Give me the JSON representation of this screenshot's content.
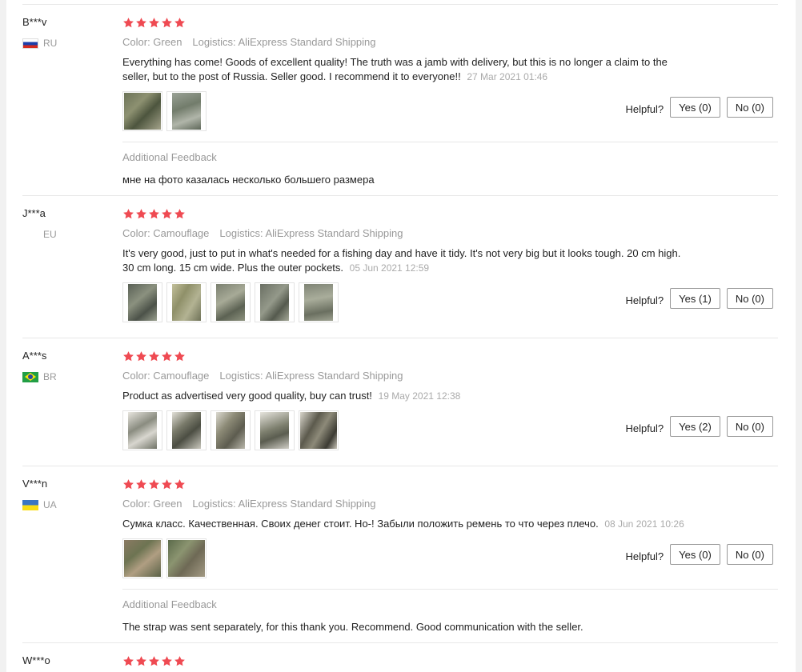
{
  "colors": {
    "star": "#ef4a52",
    "divider": "#e8e8e8",
    "muted": "#999999"
  },
  "helpful_label": "Helpful?",
  "reviews": [
    {
      "user": "B***v",
      "country": "RU",
      "flag": "ru",
      "rating": 5,
      "color": "Color: Green",
      "logistics": "Logistics: AliExpress Standard Shipping",
      "text": "Everything has come! Goods of excellent quality! The truth was a jamb with delivery, but this is no longer a claim to the seller, but to the post of Russia. Seller good. I recommend it to everyone!!",
      "date": "27 Mar 2021 01:46",
      "photos": [
        "green-bag-photo",
        "camouflage-photo"
      ],
      "yes": "Yes (0)",
      "no": "No (0)",
      "additional_label": "Additional Feedback",
      "additional_text": "мне на фото казалась несколько большего размера"
    },
    {
      "user": "J***a",
      "country": "EU",
      "flag": "eu",
      "rating": 5,
      "color": "Color: Camouflage",
      "logistics": "Logistics: AliExpress Standard Shipping",
      "text": "It's very good, just to put in what's needed for a fishing day and have it tidy. It's not very big but it looks tough. 20 cm high. 30 cm long. 15 cm wide. Plus the outer pockets.",
      "date": "05 Jun 2021 12:59",
      "photos": [
        "camo-bag-1",
        "camo-bag-2",
        "camo-bag-3",
        "camo-bag-4",
        "camo-bag-5"
      ],
      "yes": "Yes (1)",
      "no": "No (0)"
    },
    {
      "user": "A***s",
      "country": "BR",
      "flag": "br",
      "rating": 5,
      "color": "Color: Camouflage",
      "logistics": "Logistics: AliExpress Standard Shipping",
      "text": "Product as advertised very good quality, buy can trust!",
      "date": "19 May 2021 12:38",
      "photos": [
        "camo-bag-front",
        "camo-bag-side",
        "camo-bag-back",
        "camo-bag-strap",
        "camo-bag-parts"
      ],
      "yes": "Yes (2)",
      "no": "No (0)"
    },
    {
      "user": "V***n",
      "country": "UA",
      "flag": "ua",
      "rating": 5,
      "color": "Color: Green",
      "logistics": "Logistics: AliExpress Standard Shipping",
      "text": "Сумка класс. Качественная. Своих денег стоит. Но-! Забыли положить ремень то что через плечо.",
      "date": "08 Jun 2021 10:26",
      "photos": [
        "green-bag-open-1",
        "green-bag-open-2"
      ],
      "yes": "Yes (0)",
      "no": "No (0)",
      "additional_label": "Additional Feedback",
      "additional_text": "The strap was sent separately, for this thank you. Recommend. Good communication with the seller."
    },
    {
      "user": "W***o",
      "rating": 5
    }
  ]
}
